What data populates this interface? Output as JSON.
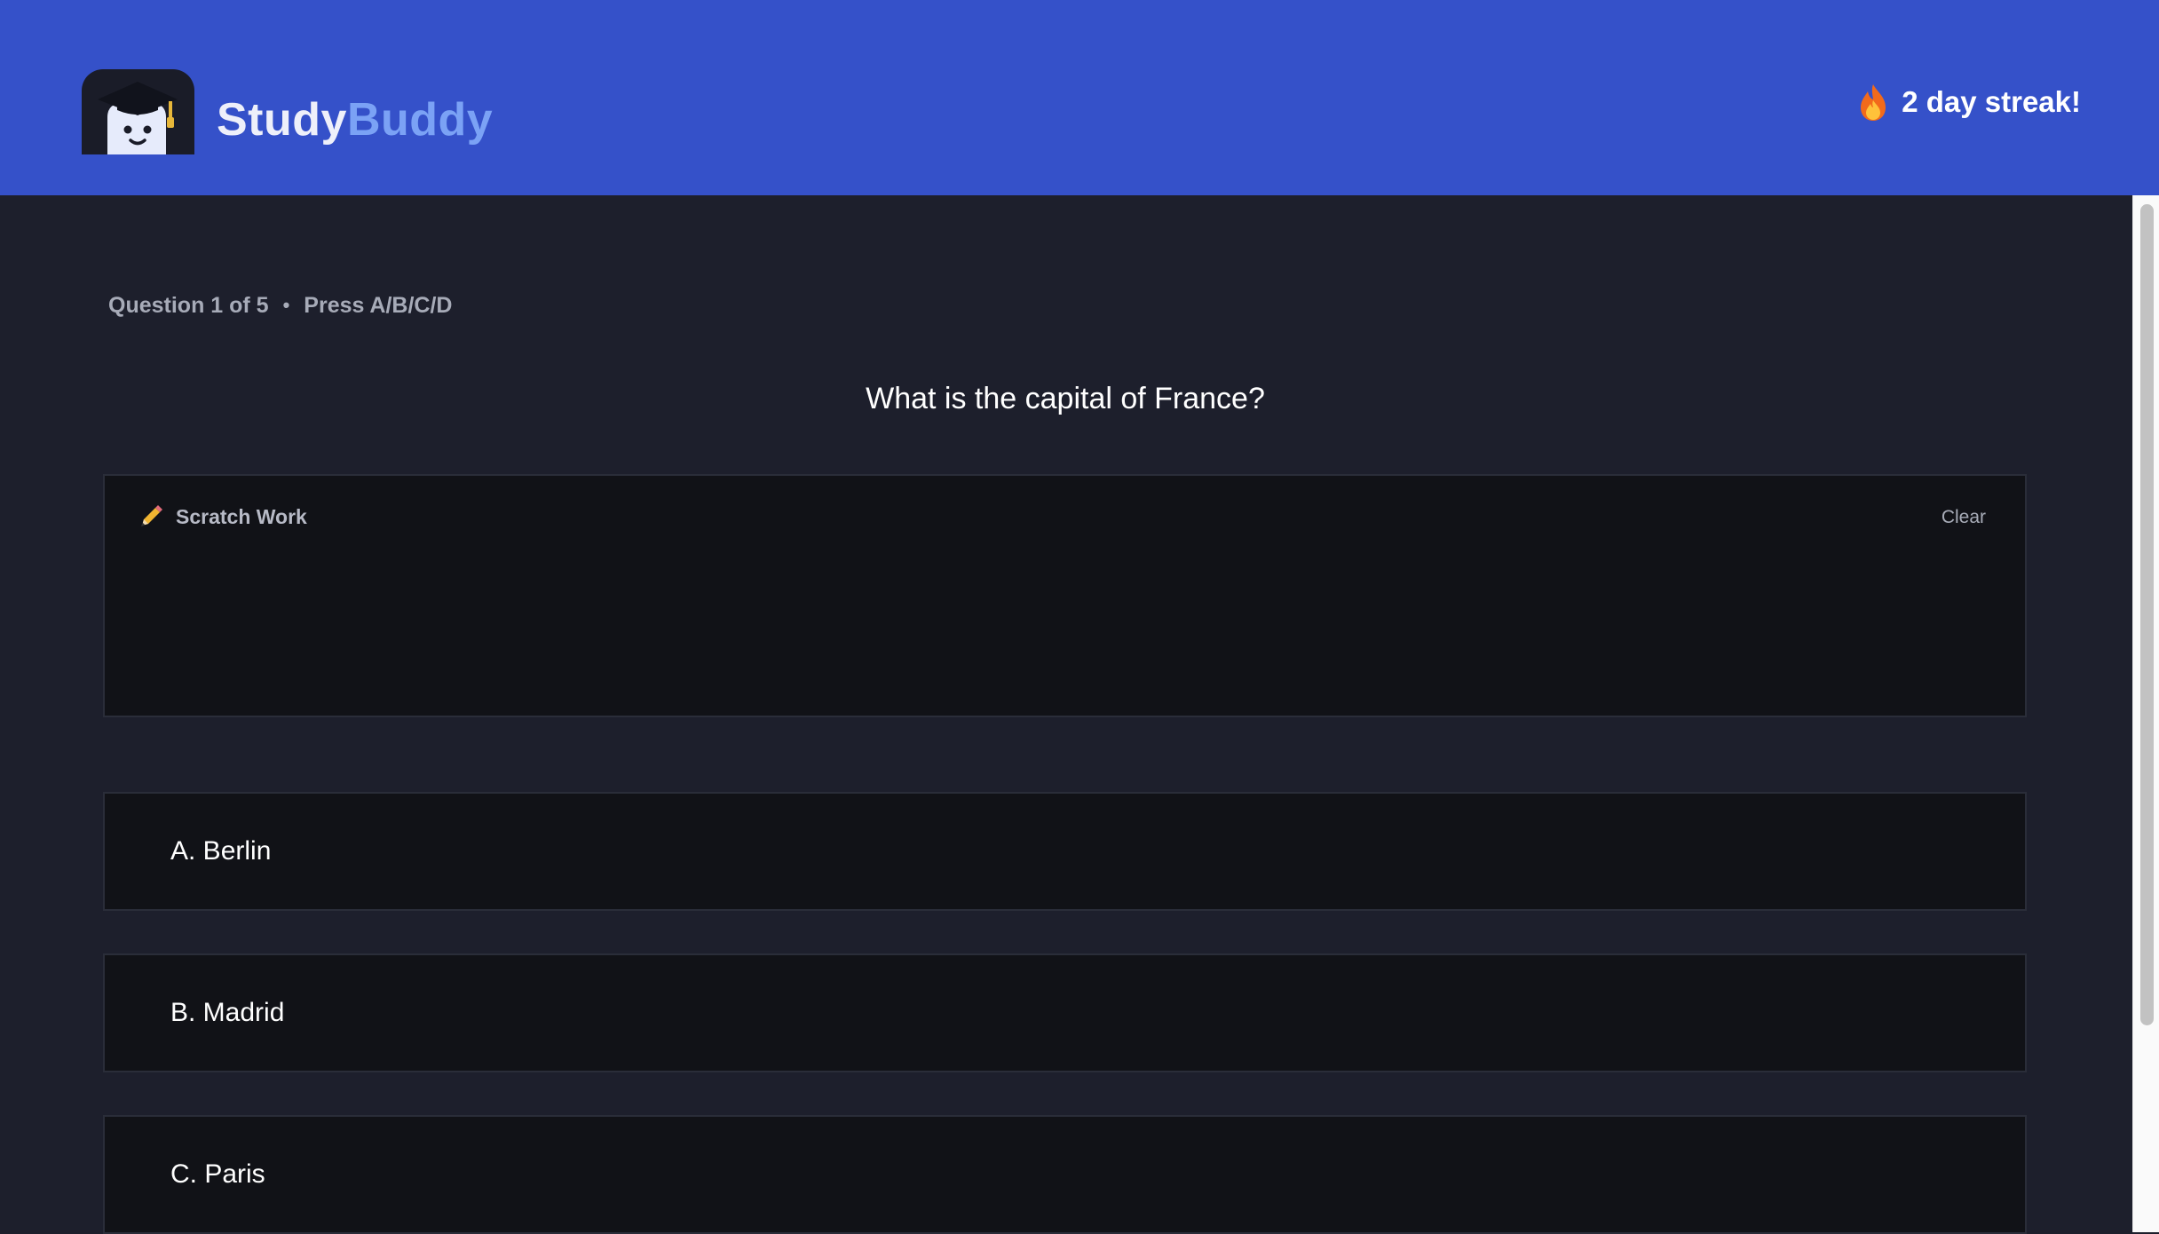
{
  "header": {
    "brand_primary": "Study",
    "brand_secondary": "Buddy",
    "streak_text": "2 day streak!",
    "streak_icon": "flame-icon",
    "logo_icon": "graduate-mascot-icon"
  },
  "quiz": {
    "progress": "Question 1 of 5",
    "separator": "•",
    "hint": "Press A/B/C/D",
    "question": "What is the capital of France?"
  },
  "scratch": {
    "icon": "pencil-icon",
    "title": "Scratch Work",
    "clear_label": "Clear"
  },
  "options": [
    {
      "label": "A. Berlin"
    },
    {
      "label": "B. Madrid"
    },
    {
      "label": "C. Paris"
    }
  ],
  "colors": {
    "header_bg": "#3551c9",
    "page_bg": "#1d1f2c",
    "panel_bg": "#111217",
    "brand_accent": "#7ba2f5"
  }
}
